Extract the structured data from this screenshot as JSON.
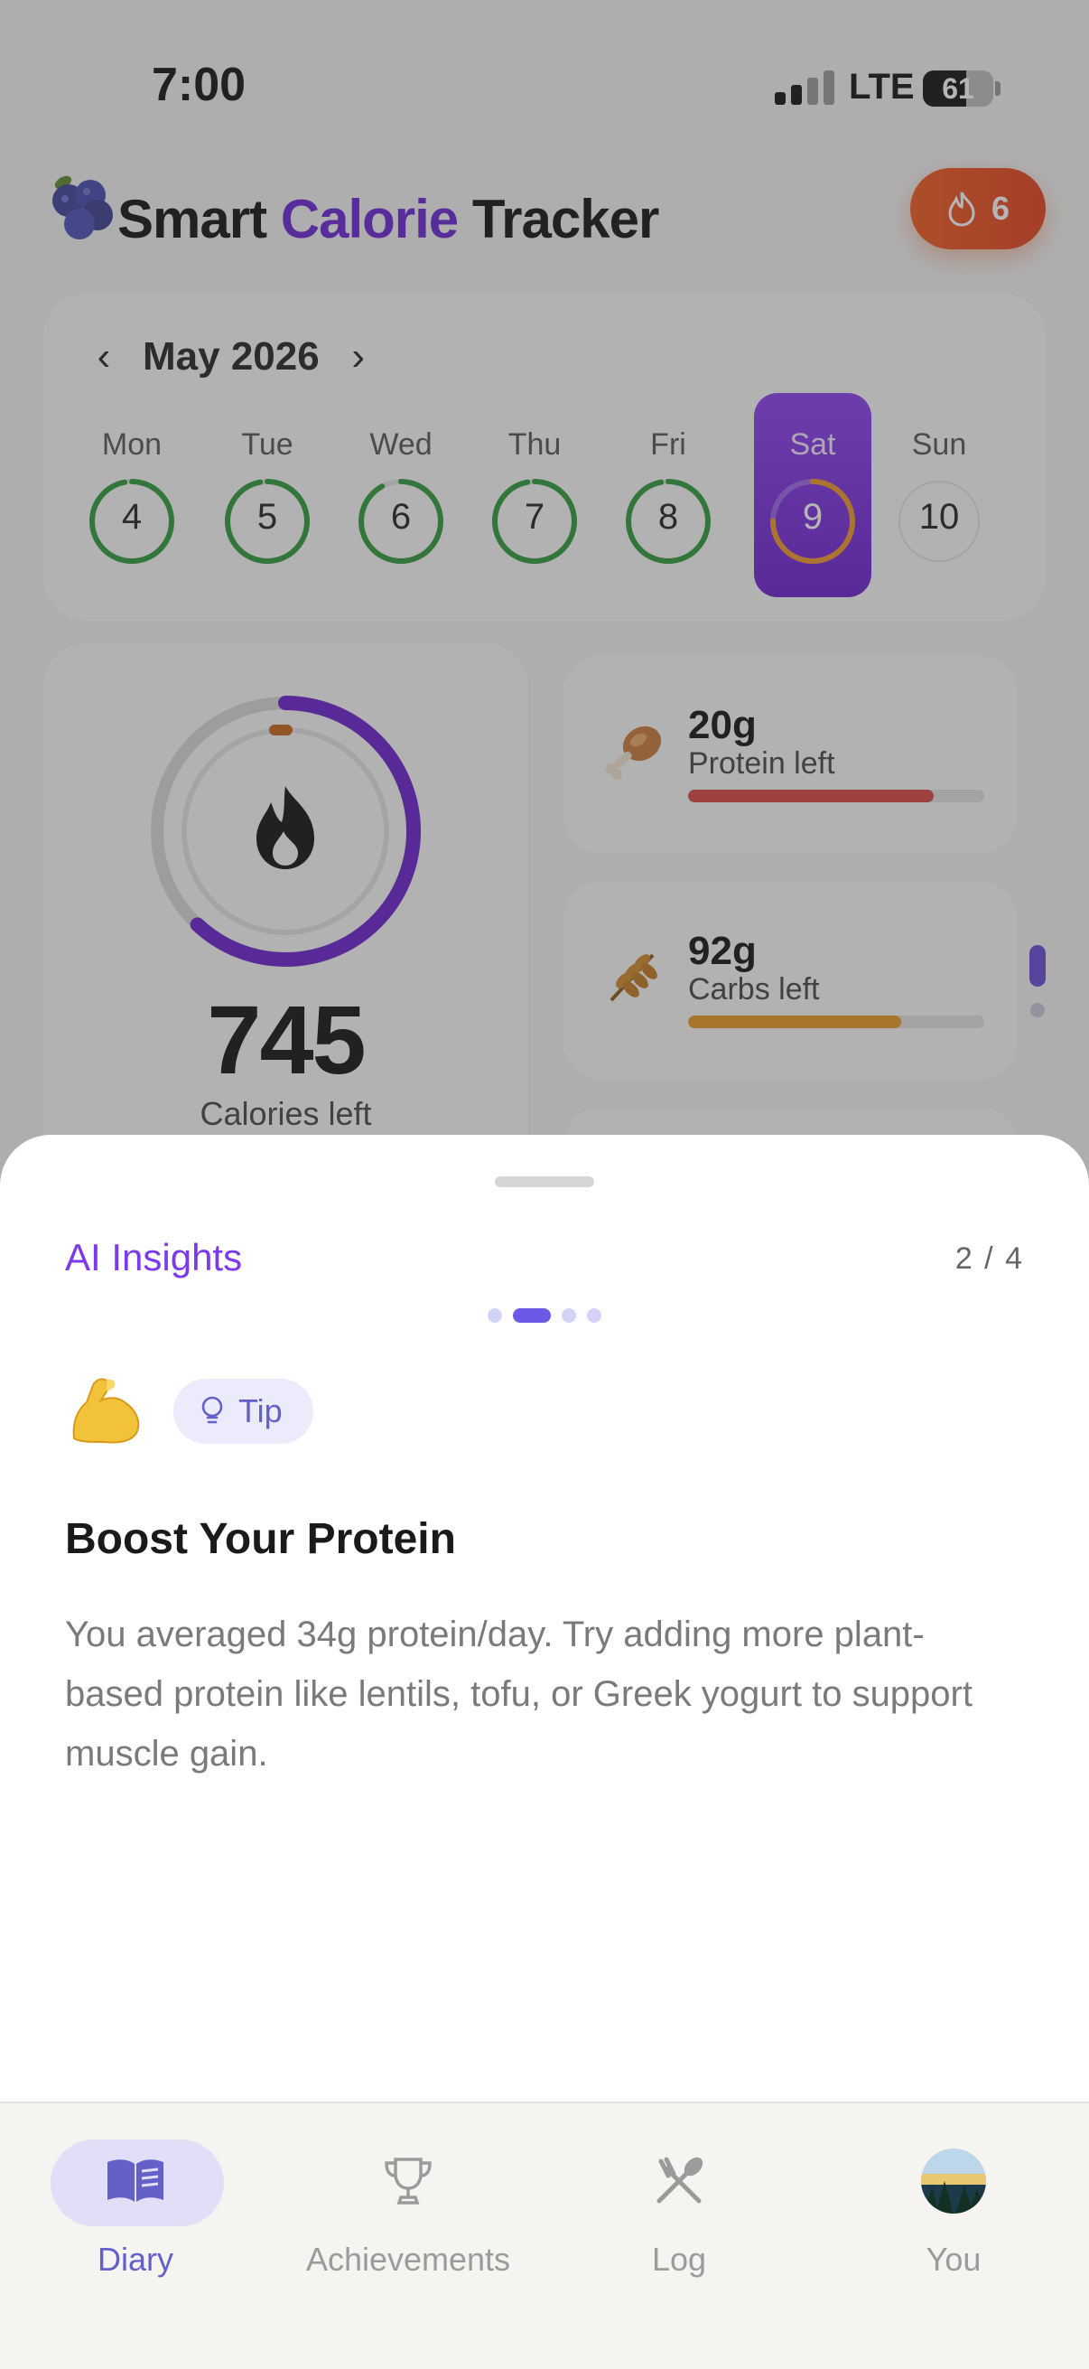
{
  "status_bar": {
    "time": "7:00",
    "network": "LTE",
    "battery": "61",
    "battery_level": 0.61
  },
  "header": {
    "title_part1": "Smart ",
    "title_accent": "Calorie",
    "title_part2": " Tracker",
    "streak_count": "6",
    "logo_icon": "blueberry-icon",
    "streak_icon": "flame-icon"
  },
  "calendar": {
    "month": "May 2026",
    "prev_icon": "chevron-left-icon",
    "next_icon": "chevron-right-icon",
    "days": [
      {
        "name": "Mon",
        "num": "4",
        "progress": 0.97,
        "color": "#2e9a3c",
        "selected": false
      },
      {
        "name": "Tue",
        "num": "5",
        "progress": 0.97,
        "color": "#2e9a3c",
        "selected": false
      },
      {
        "name": "Wed",
        "num": "6",
        "progress": 0.92,
        "color": "#2e9a3c",
        "selected": false
      },
      {
        "name": "Thu",
        "num": "7",
        "progress": 0.97,
        "color": "#2e9a3c",
        "selected": false
      },
      {
        "name": "Fri",
        "num": "8",
        "progress": 0.97,
        "color": "#2e9a3c",
        "selected": false
      },
      {
        "name": "Sat",
        "num": "9",
        "progress": 0.75,
        "color": "#f0962a",
        "selected": true
      },
      {
        "name": "Sun",
        "num": "10",
        "progress": 0,
        "color": "#cfcfcf",
        "selected": false
      }
    ]
  },
  "calories": {
    "value": "745",
    "label": "Calories left",
    "progress": 0.62,
    "icon": "flame-icon"
  },
  "macros": [
    {
      "value": "20g",
      "label": "Protein left",
      "fill": 0.83,
      "color": "#d94545",
      "icon": "drumstick-icon"
    },
    {
      "value": "92g",
      "label": "Carbs left",
      "fill": 0.72,
      "color": "#e89a22",
      "icon": "wheat-icon"
    }
  ],
  "sheet": {
    "title": "AI Insights",
    "counter": "2 / 4",
    "page_index": 2,
    "page_total": 4,
    "emoji_icon": "flexed-biceps-icon",
    "tag": "Tip",
    "tag_icon": "lightbulb-icon",
    "insight_title": "Boost Your Protein",
    "insight_body": "You averaged 34g protein/day. Try adding more plant-based protein like lentils, tofu, or Greek yogurt to support muscle gain."
  },
  "nav": {
    "items": [
      {
        "label": "Diary",
        "icon": "book-icon",
        "active": true
      },
      {
        "label": "Achievements",
        "icon": "trophy-icon",
        "active": false
      },
      {
        "label": "Log",
        "icon": "fork-spoon-icon",
        "active": false
      },
      {
        "label": "You",
        "icon": "avatar-icon",
        "active": false
      }
    ]
  },
  "colors": {
    "accent": "#7c3aed",
    "nav_active": "#6360c8",
    "streak": "#f05a1e"
  }
}
